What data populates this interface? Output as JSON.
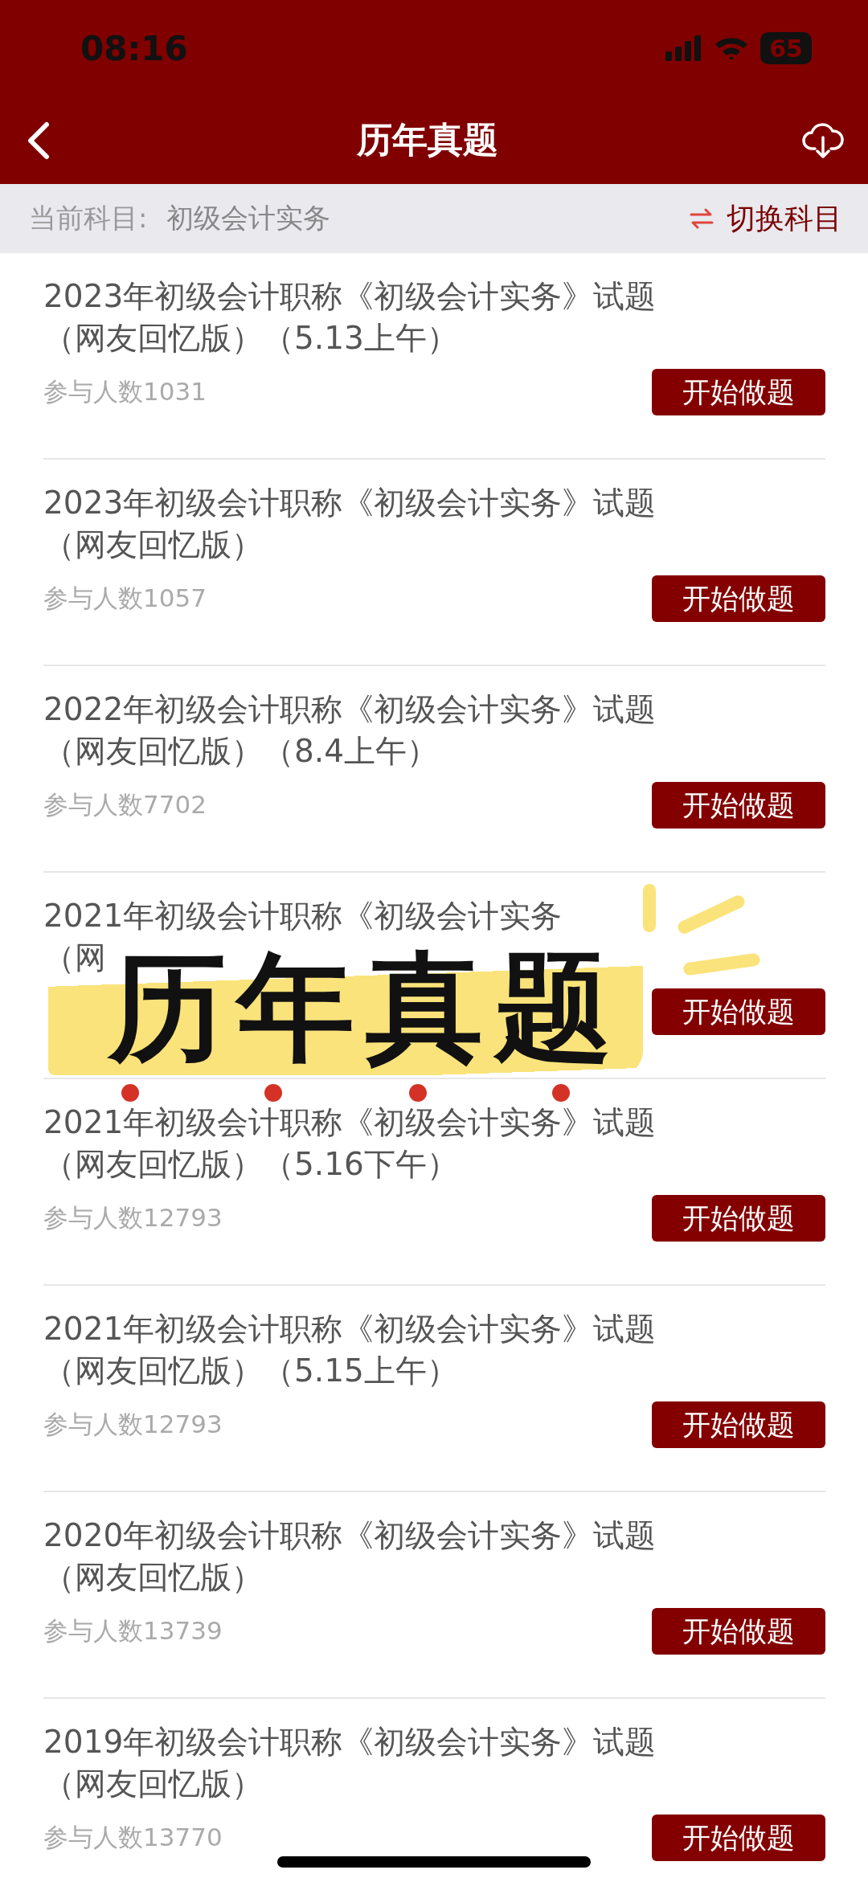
{
  "status_bar": {
    "time": "08:16",
    "battery": "65"
  },
  "header": {
    "title": "历年真题"
  },
  "subject_bar": {
    "label": "当前科目:",
    "subject": "初级会计实务",
    "switch": "切换科目"
  },
  "papers": [
    {
      "title": "2023年初级会计职称《初级会计实务》试题",
      "subtitle": "（网友回忆版）（5.13上午）",
      "count": "参与人数1031",
      "button": "开始做题"
    },
    {
      "title": "2023年初级会计职称《初级会计实务》试题",
      "subtitle": "（网友回忆版）",
      "count": "参与人数1057",
      "button": "开始做题"
    },
    {
      "title": "2022年初级会计职称《初级会计实务》试题",
      "subtitle": "（网友回忆版）（8.4上午）",
      "count": "参与人数7702",
      "button": "开始做题"
    },
    {
      "title": "2021年初级会计职称《初级会计实务",
      "subtitle": "（网",
      "button": "开始做题"
    },
    {
      "title": "2021年初级会计职称《初级会计实务》试题",
      "subtitle": "（网友回忆版）（5.16下午）",
      "count": "参与人数12793",
      "button": "开始做题"
    },
    {
      "title": "2021年初级会计职称《初级会计实务》试题",
      "subtitle": "（网友回忆版）（5.15上午）",
      "count": "参与人数12793",
      "button": "开始做题"
    },
    {
      "title": "2020年初级会计职称《初级会计实务》试题",
      "subtitle": "（网友回忆版）",
      "count": "参与人数13739",
      "button": "开始做题"
    },
    {
      "title": "2019年初级会计职称《初级会计实务》试题",
      "subtitle": "（网友回忆版）",
      "count": "参与人数13770",
      "button": "开始做题"
    }
  ],
  "sticker": {
    "text": "历年真题"
  }
}
